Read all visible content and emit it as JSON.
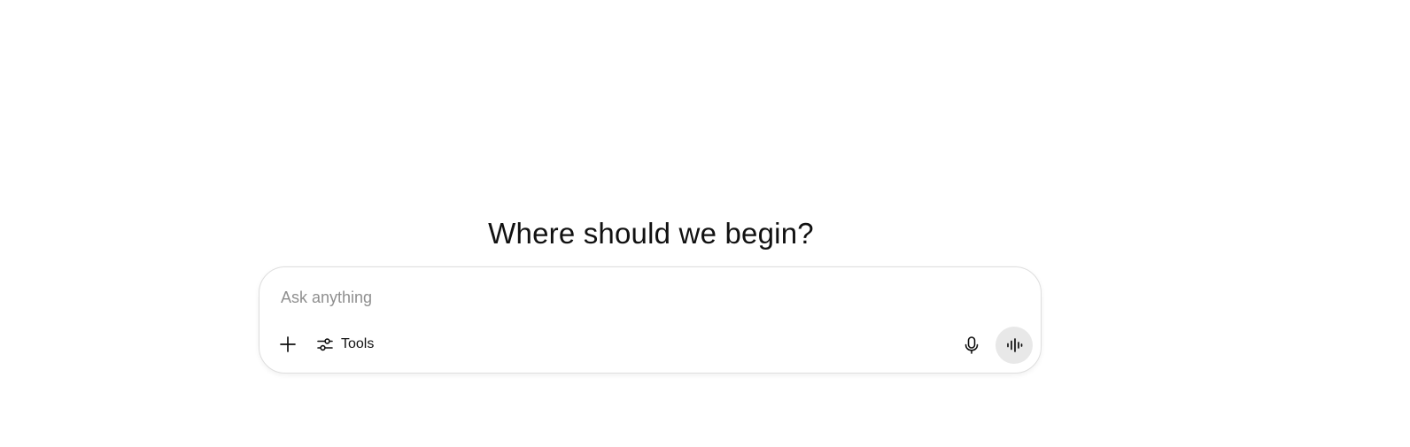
{
  "main": {
    "heading": "Where should we begin?"
  },
  "composer": {
    "placeholder": "Ask anything",
    "value": "",
    "add_icon": "plus-icon",
    "tools_icon": "sliders-icon",
    "tools_label": "Tools",
    "mic_icon": "microphone-icon",
    "voice_icon": "voice-waveform-icon"
  },
  "colors": {
    "background": "#ffffff",
    "text": "#111111",
    "placeholder": "#8f8f8f",
    "composer_border": "#dedede",
    "voice_button_bg": "#e8e8e8"
  }
}
